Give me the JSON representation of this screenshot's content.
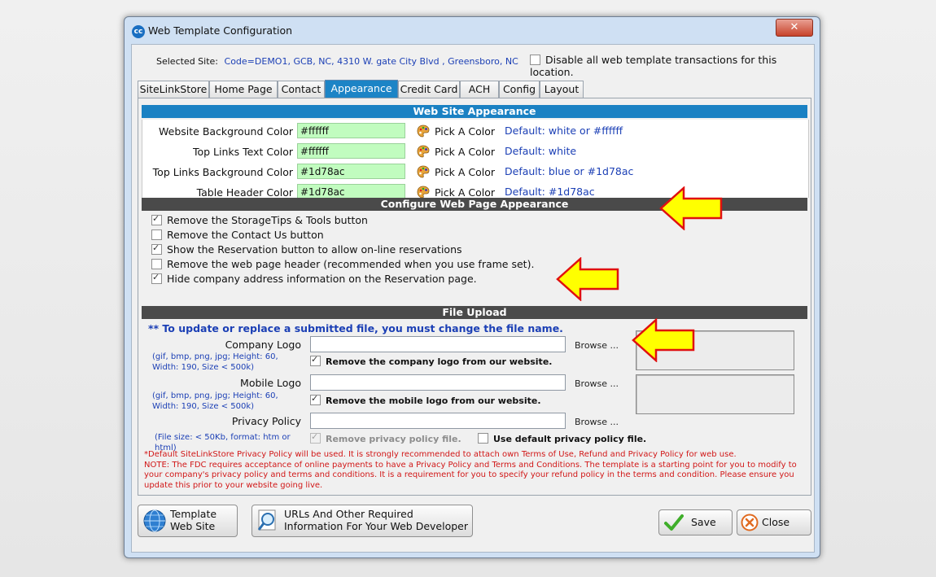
{
  "window": {
    "title": "Web Template Configuration",
    "icon_text": "cc",
    "close_glyph": "✕"
  },
  "site": {
    "label": "Selected  Site:",
    "value": "Code=DEMO1,   GCB, NC, 4310 W. gate City Blvd , Greensboro, NC",
    "disable_label": "Disable all web template transactions for this location.",
    "disable_checked": false
  },
  "tabs": [
    {
      "label": "SiteLinkStore"
    },
    {
      "label": "Home Page"
    },
    {
      "label": "Contact"
    },
    {
      "label": "Appearance",
      "active": true
    },
    {
      "label": "Credit Card"
    },
    {
      "label": "ACH"
    },
    {
      "label": "Config"
    },
    {
      "label": "Layout"
    }
  ],
  "appearance": {
    "header": "Web Site Appearance",
    "rows": [
      {
        "label": "Website Background Color",
        "value": "#ffffff",
        "pick": "Pick A Color",
        "default": "Default: white or #ffffff"
      },
      {
        "label": "Top Links Text Color",
        "value": "#ffffff",
        "pick": "Pick A Color",
        "default": "Default: white"
      },
      {
        "label": "Top Links Background Color",
        "value": "#1d78ac",
        "pick": "Pick A Color",
        "default": "Default: blue or #1d78ac"
      },
      {
        "label": "Table Header Color",
        "value": "#1d78ac",
        "pick": "Pick A Color",
        "default": "Default: #1d78ac"
      }
    ]
  },
  "configure": {
    "header": "Configure Web Page Appearance",
    "items": [
      {
        "label": "Remove the StorageTips & Tools button",
        "checked": true
      },
      {
        "label": "Remove the Contact Us button",
        "checked": false
      },
      {
        "label": "Show the Reservation button to allow on-line reservations",
        "checked": true
      },
      {
        "label": "Remove the web page header (recommended when you use frame set).",
        "checked": false
      },
      {
        "label": "Hide company address information on the Reservation page.",
        "checked": true
      }
    ]
  },
  "upload": {
    "header": "File Upload",
    "note": "** To update or replace a submitted file, you must change the file name.",
    "company_logo": {
      "label": "Company Logo",
      "value": "",
      "hint": "(gif, bmp, png, jpg; Height: 60, Width: 190, Size < 500k)",
      "browse": "Browse ...",
      "remove_label": "Remove the company logo from our website.",
      "remove_checked": true
    },
    "mobile_logo": {
      "label": "Mobile Logo",
      "value": "",
      "hint": "(gif, bmp, png, jpg; Height: 60, Width: 190, Size < 500k)",
      "browse": "Browse ...",
      "remove_label": "Remove the mobile logo from our website.",
      "remove_checked": true
    },
    "privacy": {
      "label": "Privacy Policy",
      "value": "",
      "hint": "(File size: < 50Kb, format: htm or html)",
      "browse": "Browse ...",
      "remove_label": "Remove privacy policy file.",
      "remove_checked": true,
      "default_label": "Use default privacy policy file.",
      "default_checked": false
    }
  },
  "disclaimer": "*Default SiteLinkStore Privacy Policy will be used. It is strongly recommended to attach own Terms of Use, Refund and Privacy Policy for web use.\nNOTE: The FDC requires acceptance of online payments to have a Privacy Policy and Terms and Conditions. The template is a starting point for you to modify to your company's privacy policy and terms and conditions. It is a requirement for you to specify your refund policy in the terms and condition. Please ensure you update this prior to your website going live.",
  "buttons": {
    "template_line1": "Template",
    "template_line2": "Web Site",
    "urls_line1": "URLs And Other Required",
    "urls_line2": "Information For Your Web Developer",
    "save": "Save",
    "close": "Close"
  },
  "colors": {
    "accent": "#1a81c3",
    "input_bg": "#c1fcbf",
    "arrow_fill": "#ffff00",
    "arrow_stroke": "#e01010",
    "link_blue": "#1b3fb5",
    "warning_red": "#d11818"
  }
}
